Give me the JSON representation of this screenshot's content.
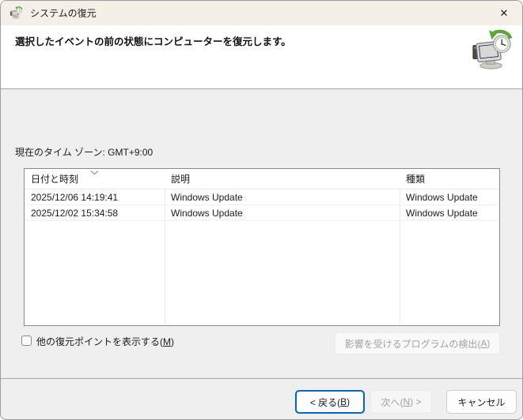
{
  "window": {
    "title": "システムの復元",
    "close_glyph": "✕"
  },
  "header": {
    "description": "選択したイベントの前の状態にコンピューターを復元します。"
  },
  "main": {
    "timezone_label": "現在のタイム ゾーン: GMT+9:00",
    "table": {
      "columns": [
        "日付と時刻",
        "説明",
        "種類"
      ],
      "sort_column": "日付と時刻",
      "sort_direction": "descending",
      "rows": [
        {
          "datetime": "2025/12/06 14:19:41",
          "description": "Windows Update",
          "type": "Windows Update"
        },
        {
          "datetime": "2025/12/02 15:34:58",
          "description": "Windows Update",
          "type": "Windows Update"
        }
      ]
    },
    "show_more_checkbox": {
      "checked": false,
      "label_pre": "他の復元ポイントを表示する(",
      "access_key": "M",
      "label_post": ")"
    },
    "scan_button": {
      "enabled": false,
      "label_pre": "影響を受けるプログラムの検出(",
      "access_key": "A",
      "label_post": ")"
    }
  },
  "footer": {
    "back_button": {
      "enabled": true,
      "label_pre": "< 戻る(",
      "access_key": "B",
      "label_post": ")"
    },
    "next_button": {
      "enabled": false,
      "label_pre": "次へ(",
      "access_key": "N",
      "label_post": ") >"
    },
    "cancel_button": {
      "label": "キャンセル"
    }
  },
  "colors": {
    "titlebar_bg": "#f4f0e8",
    "body_bg": "#efefef",
    "accent_blue": "#0067c0",
    "table_border": "#8b8b8b",
    "disabled_text": "#a3a3a3"
  }
}
